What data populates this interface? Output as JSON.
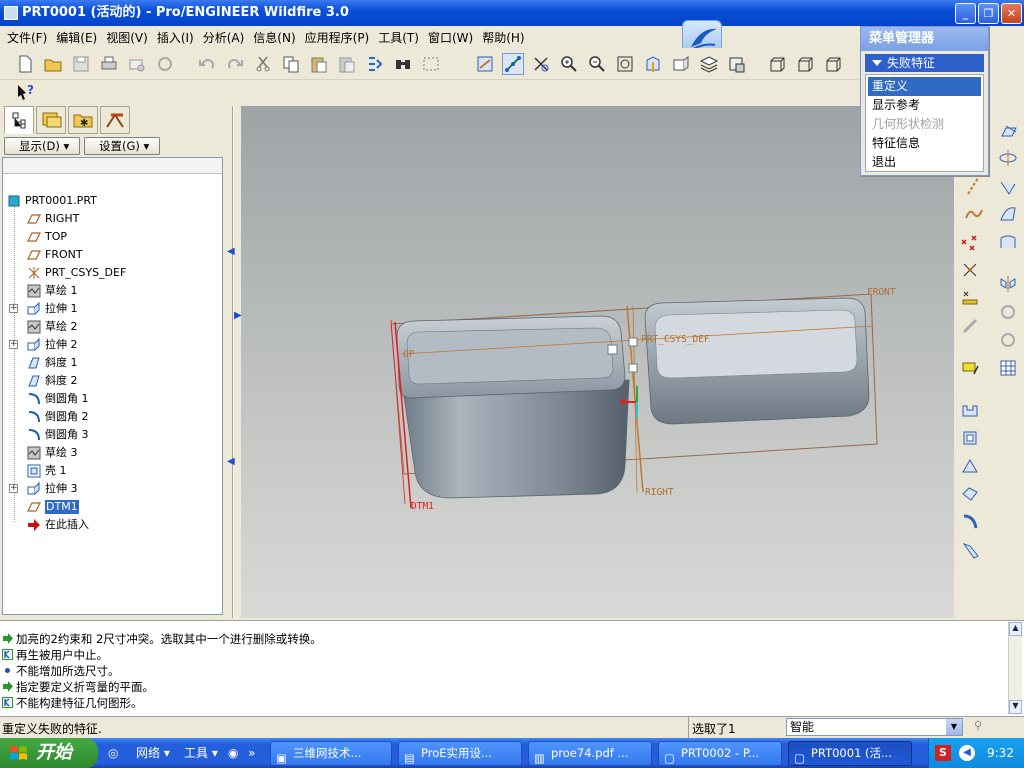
{
  "window": {
    "title": "PRT0001 (活动的) - Pro/ENGINEER Wildfire 3.0"
  },
  "menu": [
    "文件(F)",
    "编辑(E)",
    "视图(V)",
    "插入(I)",
    "分析(A)",
    "信息(N)",
    "应用程序(P)",
    "工具(T)",
    "窗口(W)",
    "帮助(H)"
  ],
  "tree_buttons": {
    "display": "显示(D)",
    "settings": "设置(G)"
  },
  "tree": {
    "root": "PRT0001.PRT",
    "items": [
      {
        "label": "RIGHT",
        "icon": "datum-plane-icon",
        "expandable": false
      },
      {
        "label": "TOP",
        "icon": "datum-plane-icon",
        "expandable": false
      },
      {
        "label": "FRONT",
        "icon": "datum-plane-icon",
        "expandable": false
      },
      {
        "label": "PRT_CSYS_DEF",
        "icon": "csys-icon",
        "expandable": false
      },
      {
        "label": "草绘 1",
        "icon": "sketch-icon",
        "expandable": false
      },
      {
        "label": "拉伸 1",
        "icon": "extrude-icon",
        "expandable": true
      },
      {
        "label": "草绘 2",
        "icon": "sketch-icon",
        "expandable": false
      },
      {
        "label": "拉伸 2",
        "icon": "extrude-icon",
        "expandable": true
      },
      {
        "label": "斜度 1",
        "icon": "draft-icon",
        "expandable": false
      },
      {
        "label": "斜度 2",
        "icon": "draft-icon",
        "expandable": false
      },
      {
        "label": "倒圆角 1",
        "icon": "round-icon",
        "expandable": false
      },
      {
        "label": "倒圆角 2",
        "icon": "round-icon",
        "expandable": false
      },
      {
        "label": "倒圆角 3",
        "icon": "round-icon",
        "expandable": false
      },
      {
        "label": "草绘 3",
        "icon": "sketch-icon",
        "expandable": false
      },
      {
        "label": "壳 1",
        "icon": "shell-icon",
        "expandable": false
      },
      {
        "label": "拉伸 3",
        "icon": "extrude-icon",
        "expandable": true
      },
      {
        "label": "DTM1",
        "icon": "datum-plane-icon",
        "expandable": false,
        "selected": true
      },
      {
        "label": "在此插入",
        "icon": "insert-arrow-icon",
        "expandable": false
      }
    ]
  },
  "viewport_labels": {
    "front": "FRONT",
    "top": "OP",
    "csys": "PRT_CSYS_DEF",
    "right": "RIGHT",
    "dtm1": "DTM1"
  },
  "menu_manager": {
    "title": "菜单管理器",
    "submenu": "失败特征",
    "items": [
      {
        "label": "重定义",
        "state": "highlighted"
      },
      {
        "label": "显示参考",
        "state": "normal"
      },
      {
        "label": "几何形状检测",
        "state": "disabled"
      },
      {
        "label": "特征信息",
        "state": "normal"
      },
      {
        "label": "退出",
        "state": "normal"
      }
    ]
  },
  "messages": [
    {
      "icon": "prompt-arrow-icon",
      "text": "加亮的2约束和 2尺寸冲突。选取其中一个进行删除或转换。"
    },
    {
      "icon": "error-icon",
      "text": "再生被用户中止。"
    },
    {
      "icon": "bullet-icon",
      "text": "不能增加所选尺寸。"
    },
    {
      "icon": "prompt-arrow-icon",
      "text": "指定要定义折弯量的平面。"
    },
    {
      "icon": "error-icon",
      "text": "不能构建特征几何图形。"
    }
  ],
  "status": {
    "left": "重定义失败的特征.",
    "selected": "选取了1",
    "filter": "智能"
  },
  "taskbar": {
    "start": "开始",
    "quicklaunch": [
      "网络",
      "工具"
    ],
    "tasks": [
      {
        "label": "三维网技术...",
        "icon": "ie-icon",
        "active": false
      },
      {
        "label": "ProE实用设...",
        "icon": "folder-icon",
        "active": false
      },
      {
        "label": "proe74.pdf ...",
        "icon": "pdf-icon",
        "active": false
      },
      {
        "label": "PRT0002 - P...",
        "icon": "proe-icon",
        "active": false
      },
      {
        "label": "PRT0001 (活...",
        "icon": "proe-icon",
        "active": true
      }
    ],
    "clock": "9:32"
  },
  "colors": {
    "titlebar": "#0a4fd8",
    "selection": "#316ac5",
    "datum": "#c07830",
    "model": "#8e9ba8"
  }
}
